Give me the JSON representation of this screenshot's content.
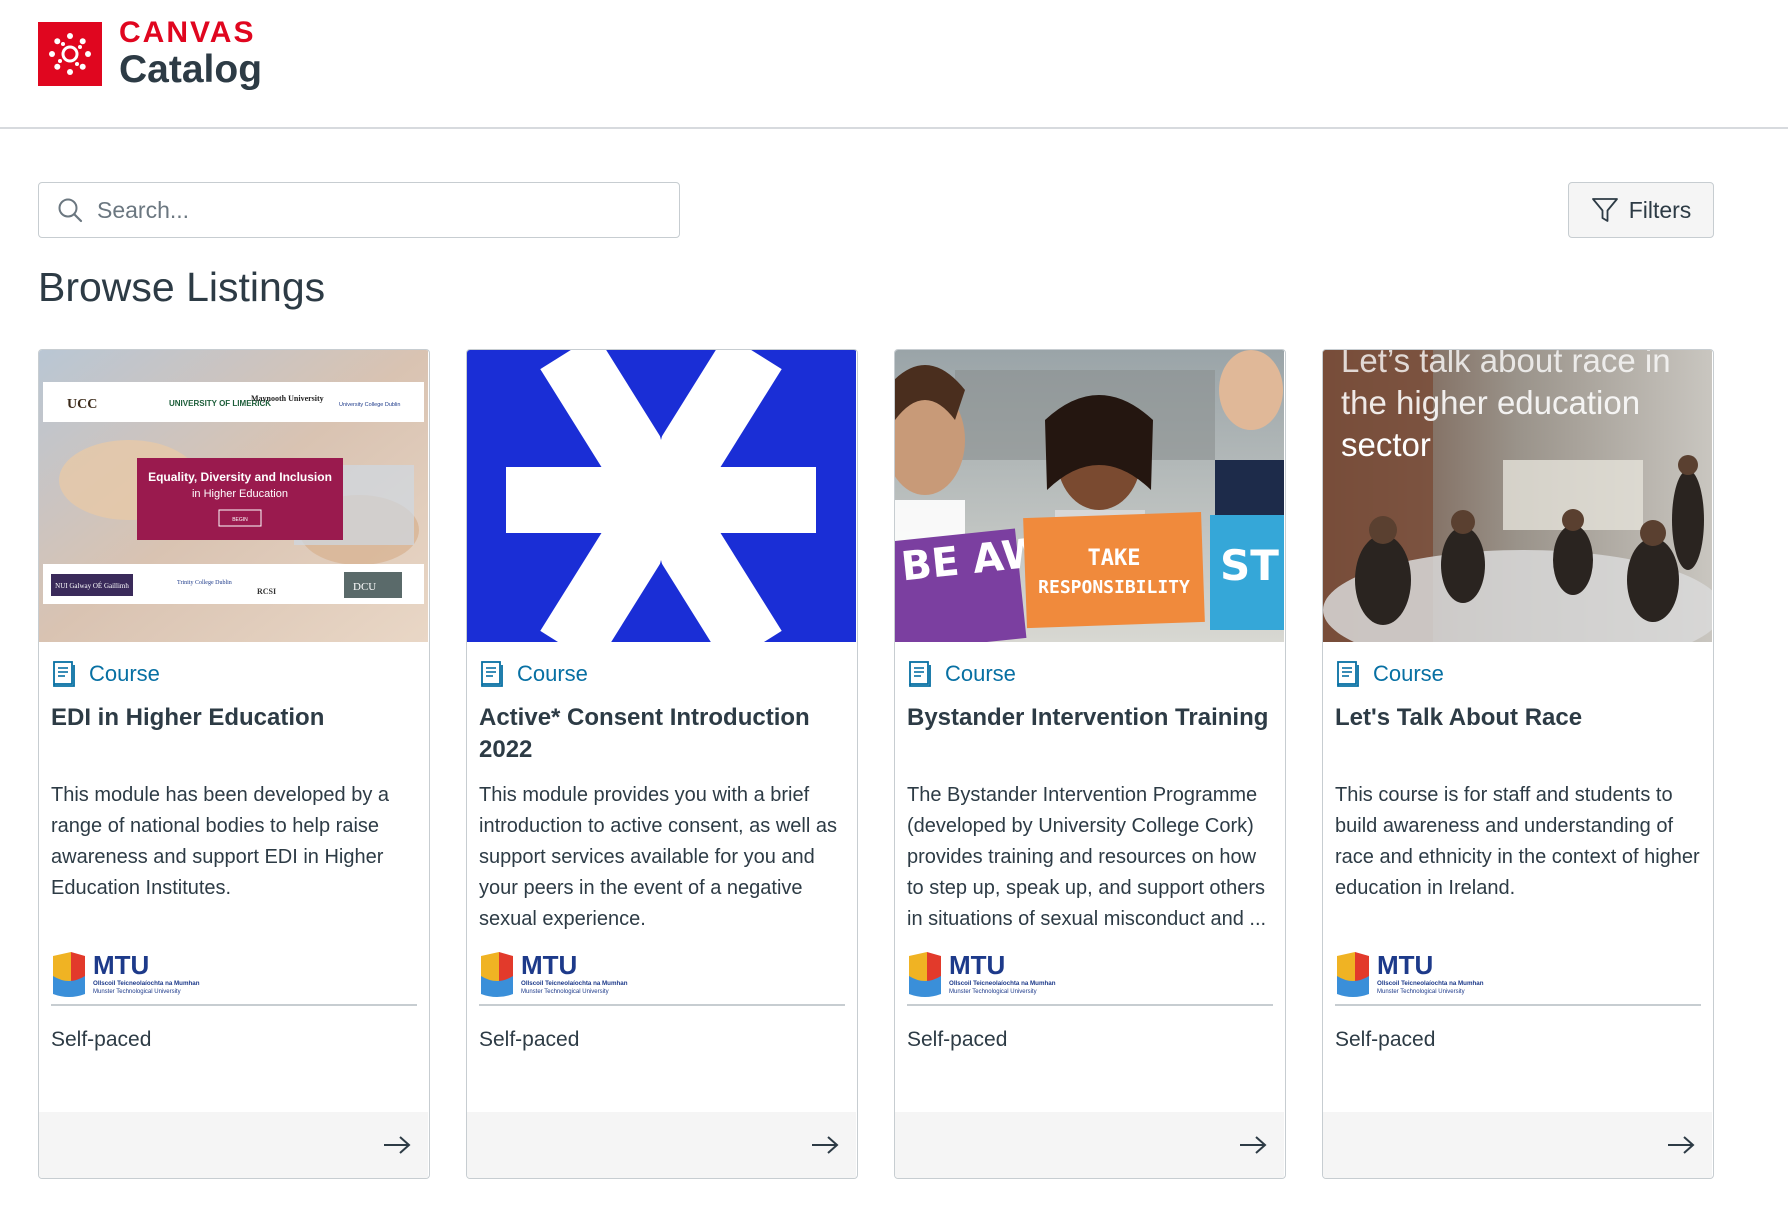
{
  "brand": {
    "name": "CANVAS",
    "product": "Catalog"
  },
  "search": {
    "placeholder": "Search...",
    "value": ""
  },
  "filters": {
    "label": "Filters"
  },
  "page_title": "Browse Listings",
  "listings": [
    {
      "type": "Course",
      "title": "EDI in Higher Education",
      "description": "This module has been developed by a range of national bodies to help raise awareness and support EDI in Higher Education Institutes.",
      "pace": "Self-paced",
      "image_text": {
        "banner_line1": "Equality, Diversity and Inclusion",
        "banner_line2": "in Higher Education",
        "banner_button": "BEGIN",
        "logos_top": [
          "UCC",
          "UNIVERSITY OF LIMERICK",
          "Maynooth University",
          "University College Dublin"
        ],
        "logos_bottom": [
          "NUI Galway OÉ Gaillimh",
          "Trinity College Dublin",
          "RCSI",
          "DCU"
        ]
      }
    },
    {
      "type": "Course",
      "title": "Active* Consent Introduction 2022",
      "description": "This module provides you with a brief introduction to active consent, as well as support services available for you and your peers in the event of a negative sexual experience.",
      "pace": "Self-paced"
    },
    {
      "type": "Course",
      "title": "Bystander Intervention Training",
      "description": "The Bystander Intervention Programme (developed by University College Cork) provides training and resources on how to step up, speak up, and support others in situations of sexual misconduct and ...",
      "pace": "Self-paced",
      "image_text": {
        "sign_left": "BE AWARE",
        "sign_center_1": "TAKE",
        "sign_center_2": "RESPONSIBILITY",
        "sign_right": "ST"
      }
    },
    {
      "type": "Course",
      "title": "Let's Talk About Race",
      "description": "This course is for staff and students to build awareness and understanding of race and ethnicity in the context of higher education in Ireland.",
      "pace": "Self-paced",
      "image_text": {
        "overlay_line1": "Let’s talk about race in",
        "overlay_line2": "the higher education",
        "overlay_line3": "sector"
      }
    }
  ],
  "provider": {
    "name": "MTU",
    "line1": "Ollscoil Teicneolaíochta na Mumhan",
    "line2": "Munster Technological University"
  },
  "colors": {
    "brand_red": "#e0061f",
    "link_blue": "#0770a3",
    "text": "#2d3b45",
    "consent_blue": "#1a2ed6",
    "edi_banner": "#9a1a4e",
    "mtu_navy": "#1d3a8a"
  },
  "icons": {
    "logo": "canvas-logo-icon",
    "search": "search-icon",
    "filter": "filter-funnel-icon",
    "course": "course-book-icon",
    "arrow": "arrow-right-icon"
  }
}
